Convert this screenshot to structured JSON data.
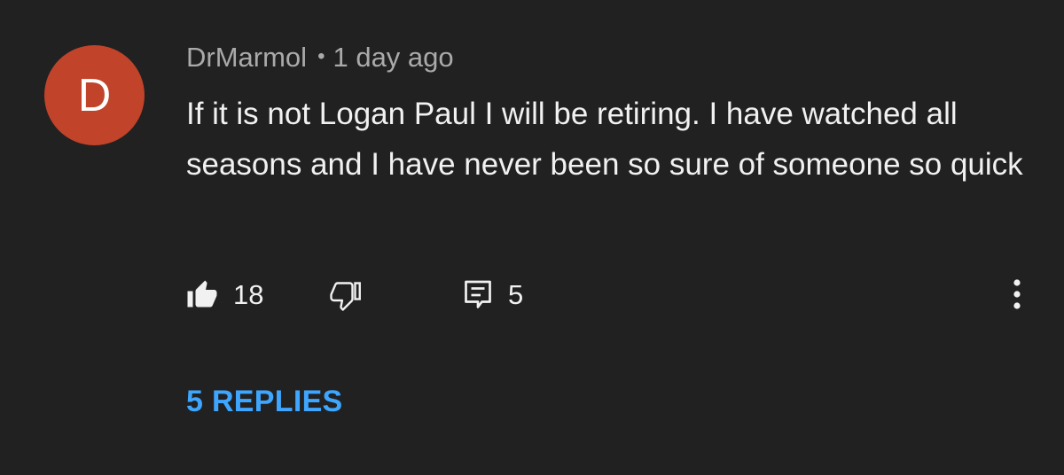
{
  "comment": {
    "avatar_letter": "D",
    "avatar_color": "#c0432a",
    "author": "DrMarmol",
    "separator": "•",
    "timestamp": "1 day ago",
    "text": "If it is not Logan Paul I will be retiring. I have watched all seasons and I have never been so sure of someone so quick",
    "likes": "18",
    "reply_count": "5",
    "replies_link": "5 REPLIES",
    "icons": {
      "like": "thumbs-up-filled-icon",
      "dislike": "thumbs-down-outline-icon",
      "reply": "comment-icon",
      "more": "more-vertical-icon"
    },
    "colors": {
      "background": "#212121",
      "link": "#3ea6ff",
      "meta_text": "#aaaaaa"
    }
  }
}
